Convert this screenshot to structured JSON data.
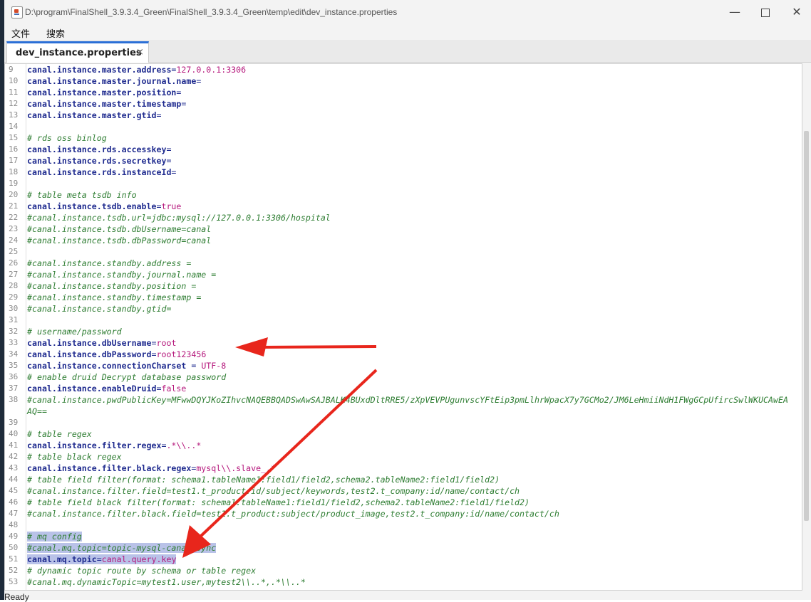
{
  "window": {
    "title": "D:\\program\\FinalShell_3.9.3.4_Green\\FinalShell_3.9.3.4_Green\\temp\\edit\\dev_instance.properties",
    "minimize_glyph": "—",
    "close_glyph": "✕"
  },
  "menu": {
    "file": "文件",
    "search": "搜索"
  },
  "tab": {
    "label": "dev_instance.properties",
    "close_glyph": "×"
  },
  "editor": {
    "lines": [
      {
        "n": "9",
        "parts": [
          [
            "k",
            "canal.instance.master.address"
          ],
          [
            "eq",
            "="
          ],
          [
            "v",
            "127.0.0.1:3306"
          ]
        ]
      },
      {
        "n": "10",
        "parts": [
          [
            "k",
            "canal.instance.master.journal.name"
          ],
          [
            "eq",
            "="
          ]
        ]
      },
      {
        "n": "11",
        "parts": [
          [
            "k",
            "canal.instance.master.position"
          ],
          [
            "eq",
            "="
          ]
        ]
      },
      {
        "n": "12",
        "parts": [
          [
            "k",
            "canal.instance.master.timestamp"
          ],
          [
            "eq",
            "="
          ]
        ]
      },
      {
        "n": "13",
        "parts": [
          [
            "k",
            "canal.instance.master.gtid"
          ],
          [
            "eq",
            "="
          ]
        ]
      },
      {
        "n": "14",
        "parts": []
      },
      {
        "n": "15",
        "parts": [
          [
            "c",
            "# rds oss binlog"
          ]
        ]
      },
      {
        "n": "16",
        "parts": [
          [
            "k",
            "canal.instance.rds.accesskey"
          ],
          [
            "eq",
            "="
          ]
        ]
      },
      {
        "n": "17",
        "parts": [
          [
            "k",
            "canal.instance.rds.secretkey"
          ],
          [
            "eq",
            "="
          ]
        ]
      },
      {
        "n": "18",
        "parts": [
          [
            "k",
            "canal.instance.rds.instanceId"
          ],
          [
            "eq",
            "="
          ]
        ]
      },
      {
        "n": "19",
        "parts": []
      },
      {
        "n": "20",
        "parts": [
          [
            "c",
            "# table meta tsdb info"
          ]
        ]
      },
      {
        "n": "21",
        "parts": [
          [
            "k",
            "canal.instance.tsdb.enable"
          ],
          [
            "eq",
            "="
          ],
          [
            "v",
            "true"
          ]
        ]
      },
      {
        "n": "22",
        "parts": [
          [
            "c",
            "#canal.instance.tsdb.url=jdbc:mysql://127.0.0.1:3306/hospital"
          ]
        ]
      },
      {
        "n": "23",
        "parts": [
          [
            "c",
            "#canal.instance.tsdb.dbUsername=canal"
          ]
        ]
      },
      {
        "n": "24",
        "parts": [
          [
            "c",
            "#canal.instance.tsdb.dbPassword=canal"
          ]
        ]
      },
      {
        "n": "25",
        "parts": []
      },
      {
        "n": "26",
        "parts": [
          [
            "c",
            "#canal.instance.standby.address ="
          ]
        ]
      },
      {
        "n": "27",
        "parts": [
          [
            "c",
            "#canal.instance.standby.journal.name ="
          ]
        ]
      },
      {
        "n": "28",
        "parts": [
          [
            "c",
            "#canal.instance.standby.position ="
          ]
        ]
      },
      {
        "n": "29",
        "parts": [
          [
            "c",
            "#canal.instance.standby.timestamp ="
          ]
        ]
      },
      {
        "n": "30",
        "parts": [
          [
            "c",
            "#canal.instance.standby.gtid="
          ]
        ]
      },
      {
        "n": "31",
        "parts": []
      },
      {
        "n": "32",
        "parts": [
          [
            "c",
            "# username/password"
          ]
        ]
      },
      {
        "n": "33",
        "parts": [
          [
            "k",
            "canal.instance.dbUsername"
          ],
          [
            "eq",
            "="
          ],
          [
            "v",
            "root"
          ]
        ]
      },
      {
        "n": "34",
        "parts": [
          [
            "k",
            "canal.instance.dbPassword"
          ],
          [
            "eq",
            "="
          ],
          [
            "v",
            "root123456"
          ]
        ]
      },
      {
        "n": "35",
        "parts": [
          [
            "k",
            "canal.instance.connectionCharset"
          ],
          [
            "eq",
            " = "
          ],
          [
            "v",
            "UTF-8"
          ]
        ]
      },
      {
        "n": "36",
        "parts": [
          [
            "c",
            "# enable druid Decrypt database password"
          ]
        ]
      },
      {
        "n": "37",
        "parts": [
          [
            "k",
            "canal.instance.enableDruid"
          ],
          [
            "eq",
            "="
          ],
          [
            "v",
            "false"
          ]
        ]
      },
      {
        "n": "38",
        "parts": [
          [
            "c",
            "#canal.instance.pwdPublicKey=MFwwDQYJKoZIhvcNAQEBBQADSwAwSAJBALK4BUxdDltRRE5/zXpVEVPUgunvscYFtEip3pmLlhrWpacX7y7GCMo2/JM6LeHmiiNdH1FWgGCpUfircSwlWKUCAwEA"
          ]
        ]
      },
      {
        "n": "",
        "parts": [
          [
            "c",
            "AQ=="
          ]
        ]
      },
      {
        "n": "39",
        "parts": []
      },
      {
        "n": "40",
        "parts": [
          [
            "c",
            "# table regex"
          ]
        ]
      },
      {
        "n": "41",
        "parts": [
          [
            "k",
            "canal.instance.filter.regex"
          ],
          [
            "eq",
            "="
          ],
          [
            "v",
            ".*\\\\..*"
          ]
        ]
      },
      {
        "n": "42",
        "parts": [
          [
            "c",
            "# table black regex"
          ]
        ]
      },
      {
        "n": "43",
        "parts": [
          [
            "k",
            "canal.instance.filter.black.regex"
          ],
          [
            "eq",
            "="
          ],
          [
            "v",
            "mysql\\\\.slave_.*"
          ]
        ]
      },
      {
        "n": "44",
        "parts": [
          [
            "c",
            "# table field filter(format: schema1.tableName1:field1/field2,schema2.tableName2:field1/field2)"
          ]
        ]
      },
      {
        "n": "45",
        "parts": [
          [
            "c",
            "#canal.instance.filter.field=test1.t_product:id/subject/keywords,test2.t_company:id/name/contact/ch"
          ]
        ]
      },
      {
        "n": "46",
        "parts": [
          [
            "c",
            "# table field black filter(format: schema1.tableName1:field1/field2,schema2.tableName2:field1/field2)"
          ]
        ]
      },
      {
        "n": "47",
        "parts": [
          [
            "c",
            "#canal.instance.filter.black.field=test1.t_product:subject/product_image,test2.t_company:id/name/contact/ch"
          ]
        ]
      },
      {
        "n": "48",
        "parts": []
      },
      {
        "n": "49",
        "parts": [
          [
            "c sel",
            "# mq config"
          ]
        ]
      },
      {
        "n": "50",
        "parts": [
          [
            "c sel",
            "#canal.mq.topic=topic-mysql-canal-sync"
          ]
        ]
      },
      {
        "n": "51",
        "parts": [
          [
            "k sel",
            "canal.mq.topic"
          ],
          [
            "eq sel",
            "="
          ],
          [
            "v sel",
            "canal.query.key"
          ]
        ]
      },
      {
        "n": "52",
        "parts": [
          [
            "c",
            "# dynamic topic route by schema or table regex"
          ]
        ]
      },
      {
        "n": "53",
        "parts": [
          [
            "c",
            "#canal.mq.dynamicTopic=mytest1.user,mytest2\\\\..*,.*\\\\..*"
          ]
        ]
      }
    ]
  },
  "status": {
    "text": "Ready"
  },
  "colors": {
    "key": "#1f2b8f",
    "value": "#b5177c",
    "comment": "#2e7d32",
    "selection": "#b9c2e8",
    "arrow": "#e8261c",
    "tab_accent": "#2b6fd6"
  },
  "annotation": {
    "arrow_count": 2
  }
}
